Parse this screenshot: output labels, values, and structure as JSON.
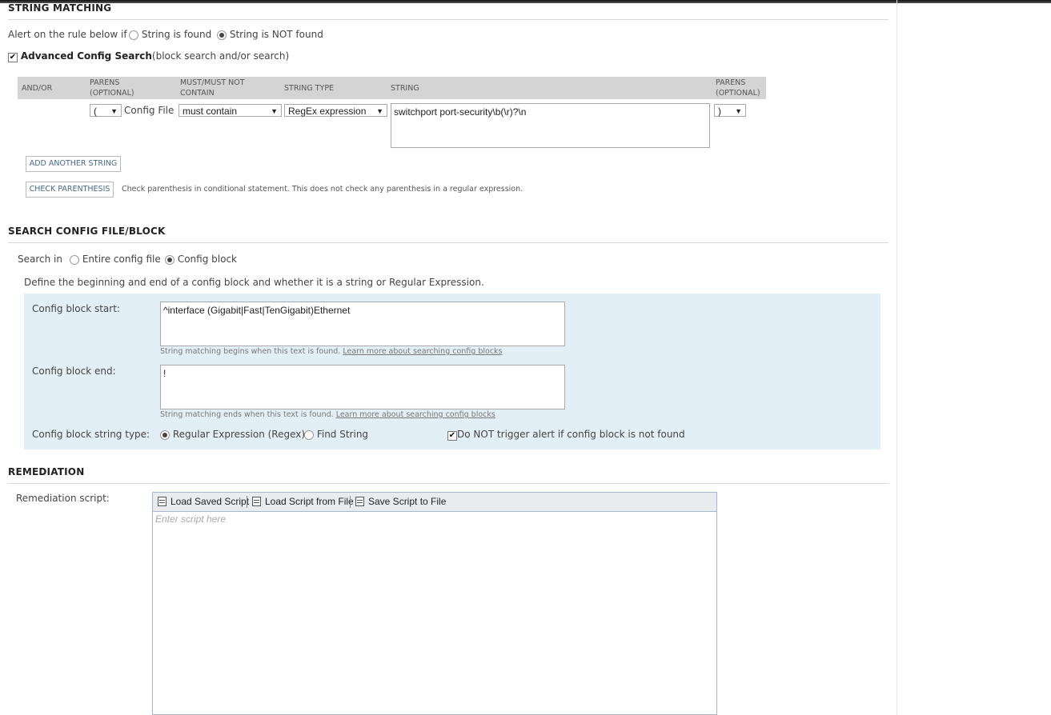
{
  "string_matching": {
    "title": "STRING MATCHING",
    "alert_label": "Alert on the rule below if",
    "opt_found": "String is found",
    "opt_not_found": "String is NOT found",
    "selected": "not_found",
    "advanced_label": "Advanced Config Search",
    "advanced_suffix": "(block search and/or search)",
    "advanced_checked": true,
    "table": {
      "headers": {
        "andor": "AND/OR",
        "parens_open": [
          "PARENS",
          "(OPTIONAL)"
        ],
        "must": [
          "MUST/MUST NOT",
          "CONTAIN"
        ],
        "string_type": "STRING TYPE",
        "string": "STRING",
        "parens_close": [
          "PARENS",
          "(OPTIONAL)"
        ]
      },
      "row": {
        "paren_open": "(",
        "source": "Config File",
        "must": "must contain",
        "string_type": "RegEx expression",
        "string": "switchport port-security\\b(\\r)?\\n",
        "paren_close": ")"
      }
    },
    "add_button": "ADD ANOTHER STRING",
    "check_button": "CHECK PARENTHESIS",
    "check_note": "Check parenthesis in conditional statement. This does not check any parenthesis in a regular expression."
  },
  "search_config": {
    "title": "SEARCH CONFIG FILE/BLOCK",
    "search_in_label": "Search in",
    "opt_entire": "Entire config file",
    "opt_block": "Config block",
    "selected": "block",
    "define_text": "Define the beginning and end of a config block and whether it is a string or Regular Expression.",
    "start_label": "Config block start:",
    "start_value": "^interface (Gigabit|Fast|TenGigabit)Ethernet",
    "start_hint": "String matching begins when this text is found.",
    "end_label": "Config block end:",
    "end_value": "!",
    "end_hint": "String matching ends when this text is found.",
    "learn_more": "Learn more about searching config blocks",
    "type_label": "Config block string type:",
    "opt_regex": "Regular Expression (Regex)",
    "opt_find": "Find String",
    "type_selected": "regex",
    "no_trigger_label": "Do NOT trigger alert if config block is not found",
    "no_trigger_checked": true
  },
  "remediation": {
    "title": "REMEDIATION",
    "script_label": "Remediation script:",
    "toolbar": {
      "load_saved": "Load Saved Script",
      "load_file": "Load Script from File",
      "save_file": "Save Script to File"
    },
    "placeholder": "Enter script here"
  }
}
